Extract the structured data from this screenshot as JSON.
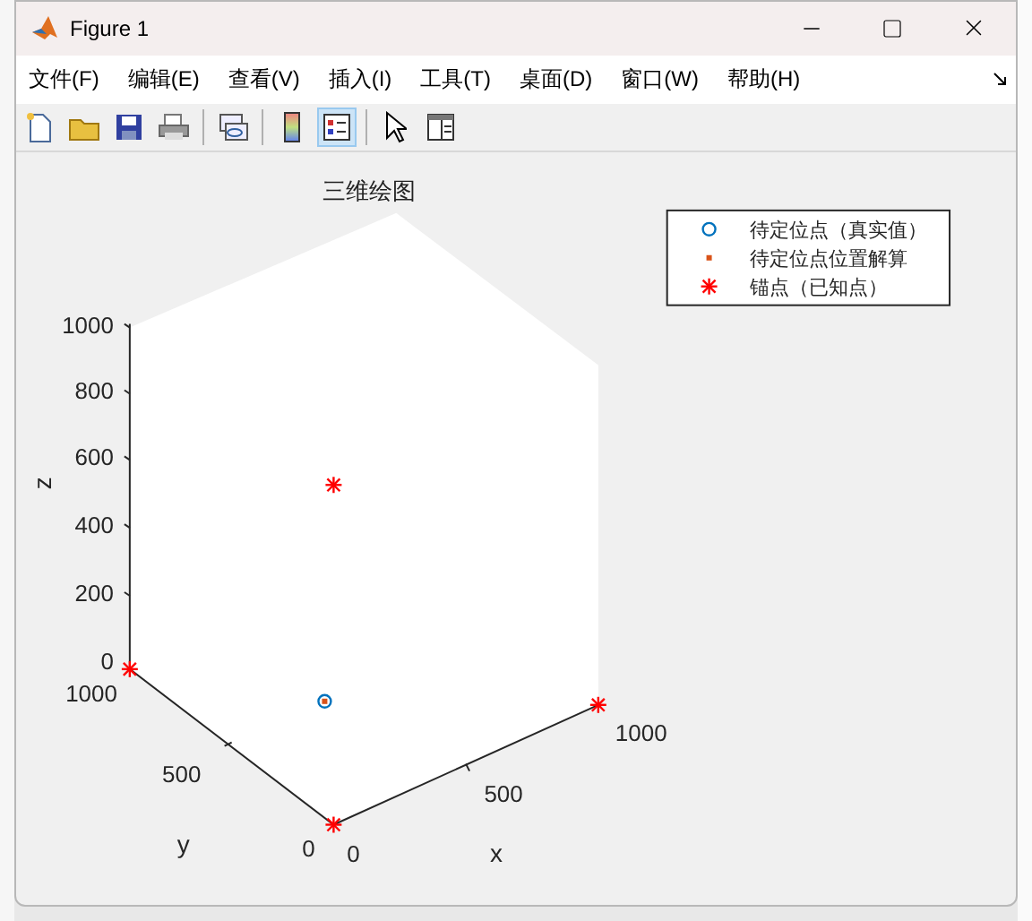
{
  "window": {
    "title": "Figure 1"
  },
  "menu": [
    {
      "label": "文件(F)"
    },
    {
      "label": "编辑(E)"
    },
    {
      "label": "查看(V)"
    },
    {
      "label": "插入(I)"
    },
    {
      "label": "工具(T)"
    },
    {
      "label": "桌面(D)"
    },
    {
      "label": "窗口(W)"
    },
    {
      "label": "帮助(H)"
    }
  ],
  "toolbar": [
    {
      "kind": "new",
      "selected": false
    },
    {
      "kind": "open",
      "selected": false
    },
    {
      "kind": "save",
      "selected": false
    },
    {
      "kind": "print",
      "selected": false
    },
    {
      "kind": "separator"
    },
    {
      "kind": "link",
      "selected": false
    },
    {
      "kind": "separator"
    },
    {
      "kind": "colorbar",
      "selected": false
    },
    {
      "kind": "legend",
      "selected": true
    },
    {
      "kind": "separator"
    },
    {
      "kind": "pointer",
      "selected": false
    },
    {
      "kind": "inspector",
      "selected": false
    }
  ],
  "plot": {
    "title": "三维绘图",
    "axes": [
      {
        "kind": "z",
        "label": "z",
        "ticks": [
          "1000",
          "800",
          "600",
          "400",
          "200",
          "0"
        ]
      },
      {
        "kind": "y",
        "label": "y",
        "ticks": [
          "1000",
          "500",
          "0"
        ]
      },
      {
        "kind": "x",
        "label": "x",
        "ticks": [
          "0",
          "500",
          "1000"
        ]
      }
    ],
    "legend": [
      {
        "kind": "circle",
        "label": "待定位点（真实值）",
        "color": "#0072bd"
      },
      {
        "kind": "dot",
        "label": "待定位点位置解算",
        "color": "#d95319"
      },
      {
        "kind": "star",
        "label": "锚点（已知点）",
        "color": "#ff0000"
      }
    ]
  }
}
